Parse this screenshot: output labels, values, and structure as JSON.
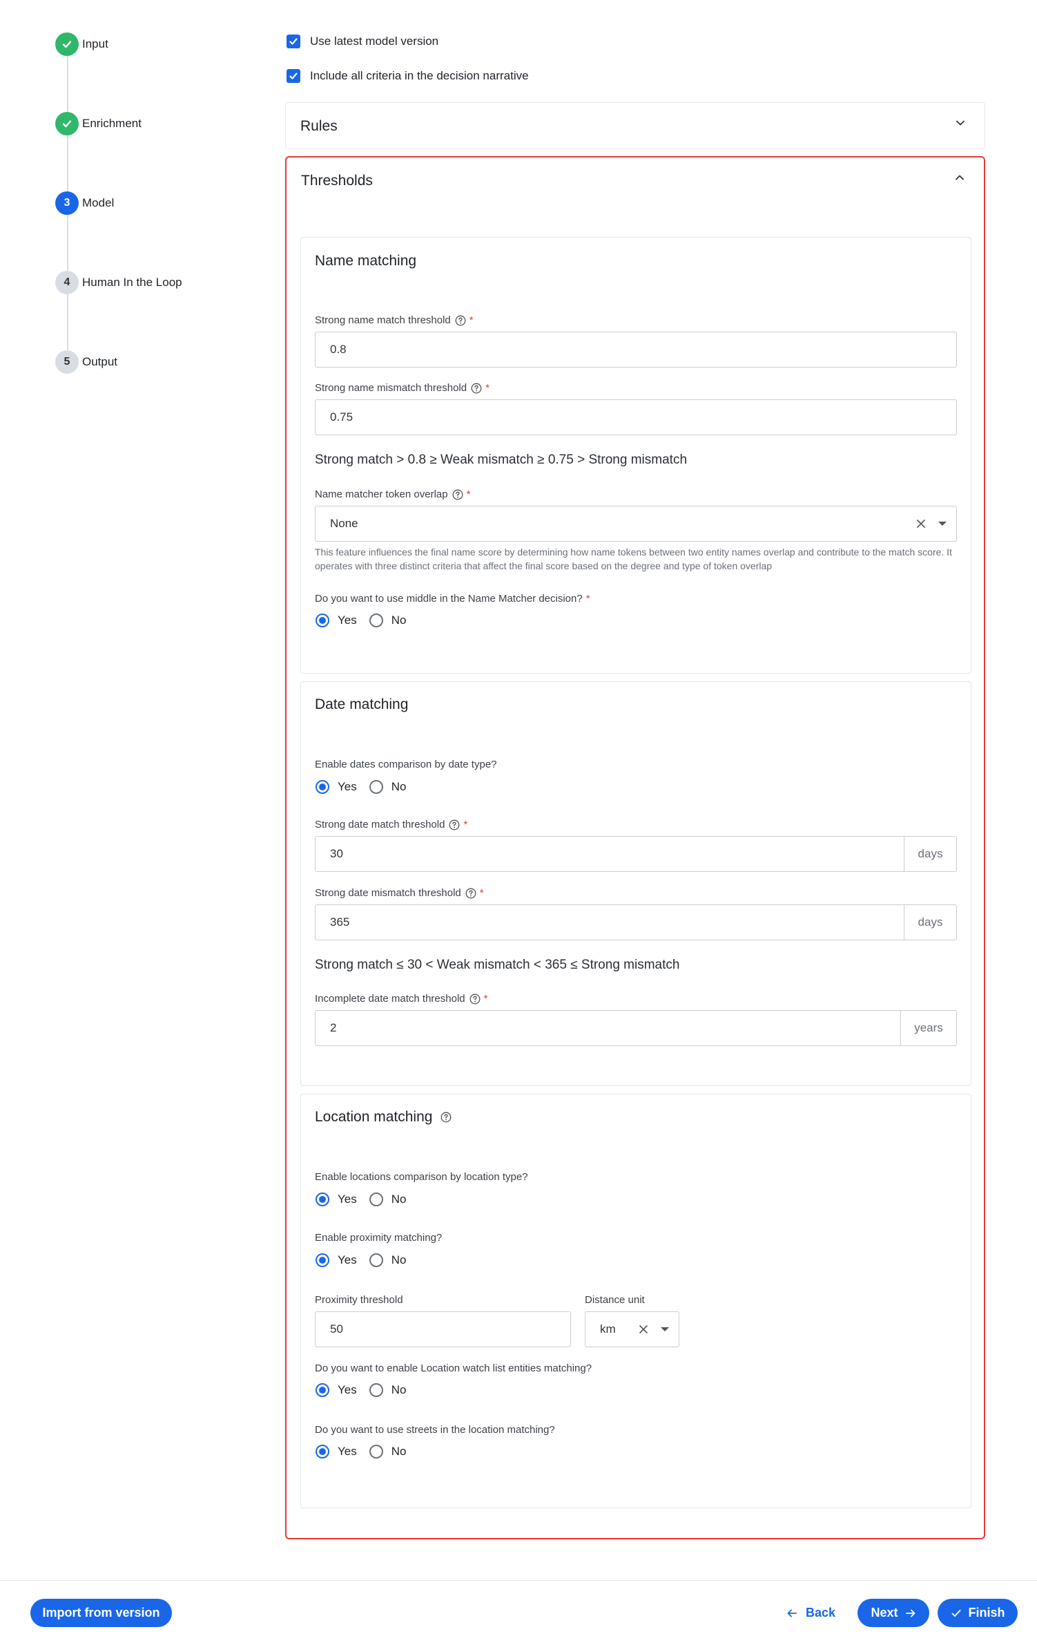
{
  "stepper": {
    "steps": [
      {
        "label": "Input",
        "number": "1",
        "state": "done"
      },
      {
        "label": "Enrichment",
        "number": "2",
        "state": "done"
      },
      {
        "label": "Model",
        "number": "3",
        "state": "active"
      },
      {
        "label": "Human In the Loop",
        "number": "4",
        "state": "pending"
      },
      {
        "label": "Output",
        "number": "5",
        "state": "pending"
      }
    ]
  },
  "options": {
    "use_latest": {
      "label": "Use latest model version",
      "checked": true
    },
    "include_all": {
      "label": "Include all criteria in the decision narrative",
      "checked": true
    }
  },
  "rules": {
    "title": "Rules",
    "expanded": false
  },
  "thresholds": {
    "title": "Thresholds",
    "expanded": true,
    "name_matching": {
      "title": "Name matching",
      "strong_match": {
        "label": "Strong name match threshold",
        "value": "0.8"
      },
      "strong_mismatch": {
        "label": "Strong name mismatch threshold",
        "value": "0.75"
      },
      "formula": "Strong match > 0.8 ≥ Weak mismatch ≥ 0.75 > Strong mismatch",
      "token_overlap": {
        "label": "Name matcher token overlap",
        "value": "None",
        "helper": "This feature influences the final name score by determining how name tokens between two entity names overlap and contribute to the match score. It operates with three distinct criteria that affect the final score based on the degree and type of token overlap"
      },
      "middle": {
        "question": "Do you want to use middle in the Name Matcher decision?",
        "selected": "Yes"
      }
    },
    "date_matching": {
      "title": "Date matching",
      "by_type": {
        "question": "Enable dates comparison by date type?",
        "selected": "Yes"
      },
      "strong_match": {
        "label": "Strong date match threshold",
        "value": "30",
        "unit": "days"
      },
      "strong_mismatch": {
        "label": "Strong date mismatch threshold",
        "value": "365",
        "unit": "days"
      },
      "formula": "Strong match ≤ 30 < Weak mismatch < 365 ≤  Strong mismatch",
      "incomplete": {
        "label": "Incomplete date match threshold",
        "value": "2",
        "unit": "years"
      }
    },
    "location_matching": {
      "title": "Location matching",
      "by_type": {
        "question": "Enable locations comparison by location type?",
        "selected": "Yes"
      },
      "proximity": {
        "question": "Enable proximity matching?",
        "selected": "Yes"
      },
      "proximity_threshold": {
        "label": "Proximity threshold",
        "value": "50"
      },
      "distance_unit": {
        "label": "Distance unit",
        "value": "km"
      },
      "watchlist": {
        "question": "Do you want to enable Location watch list entities matching?",
        "selected": "Yes"
      },
      "streets": {
        "question": "Do you want to use streets in the location matching?",
        "selected": "Yes"
      }
    }
  },
  "radio_labels": {
    "yes": "Yes",
    "no": "No"
  },
  "footer": {
    "import_label": "Import from version",
    "back_label": "Back",
    "next_label": "Next",
    "finish_label": "Finish"
  },
  "colors": {
    "primary": "#1967e8",
    "success": "#2fb86a",
    "highlight_border": "#e53935",
    "required": "#e53935"
  }
}
